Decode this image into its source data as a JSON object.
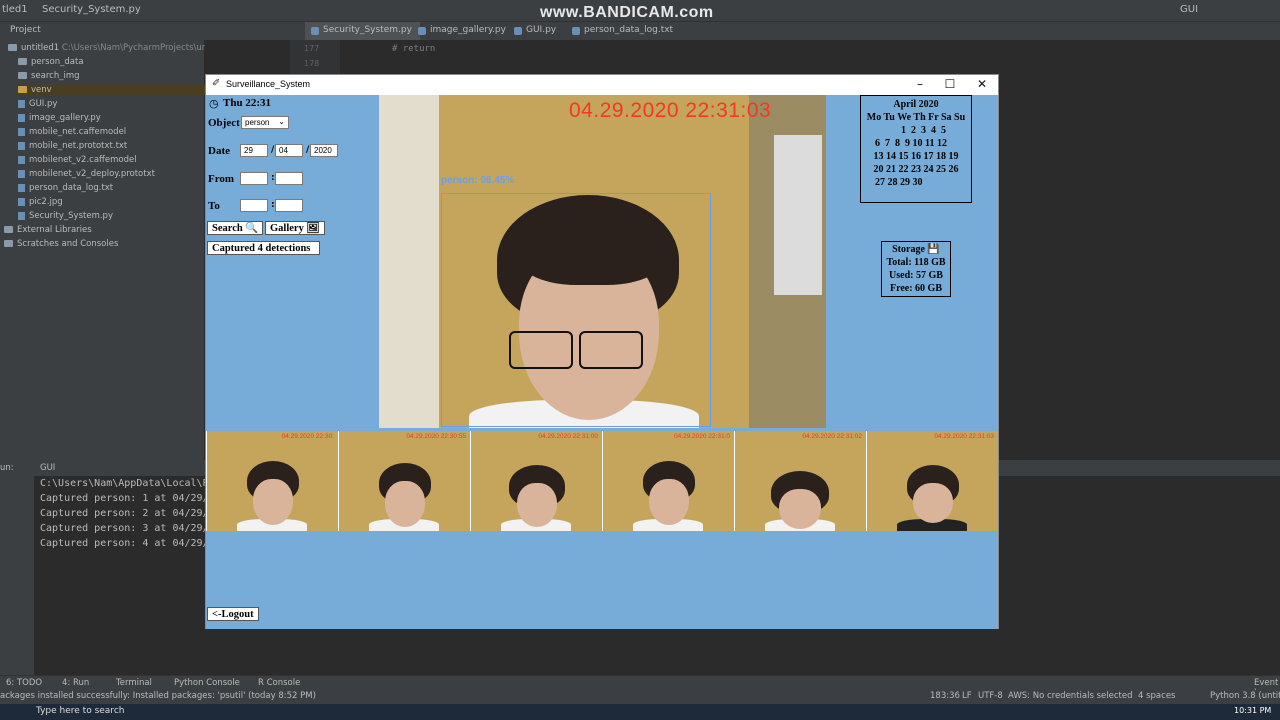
{
  "watermark": "www.BANDICAM.com",
  "ide": {
    "title_project": "tled1",
    "title_file": "Security_System.py",
    "project_label": "Project",
    "config": "GUI",
    "tabs": [
      "Security_System.py",
      "image_gallery.py",
      "GUI.py",
      "person_data_log.txt"
    ],
    "tree": [
      {
        "label": "untitled1",
        "extra": "C:\\Users\\Nam\\PycharmProjects\\untitled1",
        "type": "folder"
      },
      {
        "label": "person_data",
        "type": "folder"
      },
      {
        "label": "search_img",
        "type": "folder"
      },
      {
        "label": "venv",
        "type": "folder"
      },
      {
        "label": "GUI.py",
        "type": "file"
      },
      {
        "label": "image_gallery.py",
        "type": "file"
      },
      {
        "label": "mobile_net.caffemodel",
        "type": "file"
      },
      {
        "label": "mobile_net.prototxt.txt",
        "type": "file"
      },
      {
        "label": "mobilenet_v2.caffemodel",
        "type": "file"
      },
      {
        "label": "mobilenet_v2_deploy.prototxt",
        "type": "file"
      },
      {
        "label": "person_data_log.txt",
        "type": "file"
      },
      {
        "label": "pic2.jpg",
        "type": "file"
      },
      {
        "label": "Security_System.py",
        "type": "file"
      },
      {
        "label": "External Libraries",
        "type": "folder"
      },
      {
        "label": "Scratches and Consoles",
        "type": "folder"
      }
    ],
    "line_numbers": [
      "177",
      "178"
    ],
    "code_comment": "# return",
    "run_label": "un:",
    "run_tab": "GUI",
    "run_output": [
      "C:\\Users\\Nam\\AppData\\Local\\Pro",
      "Captured person: 1 at 04/29/20",
      "Captured person: 2 at 04/29/20",
      "Captured person: 3 at 04/29/20",
      "Captured person: 4 at 04/29/20"
    ],
    "bottom_tabs": [
      "6: TODO",
      "4: Run",
      "Terminal",
      "Python Console",
      "R Console",
      "Event L"
    ],
    "status_message": "ackages installed successfully: Installed packages: 'psutil' (today 8:52 PM)",
    "status_right": [
      "183:36",
      "LF",
      "UTF-8",
      "AWS: No credentials selected",
      "4 spaces",
      "Python 3.8 (untitle"
    ],
    "taskbar_search": "Type here to search",
    "taskbar_time": "10:31 PM"
  },
  "app": {
    "window_title": "Surveillance_System",
    "clock": "Thu 22:31",
    "object_label": "Object",
    "object_value": "person",
    "date_label": "Date",
    "date_day": "29",
    "date_month": "04",
    "date_year": "2020",
    "from_label": "From",
    "to_label": "To",
    "search_button": "Search 🔍",
    "gallery_button": "Gallery 🖼",
    "detections_text": "Captured 4 detections",
    "logout_button": "<-Logout",
    "video_timestamp": "04.29.2020  22:31:03",
    "detection_label": "person: 96.45%",
    "thumb_timestamps": [
      "04.29.2020 22:30:",
      "04.29.2020 22:30:55",
      "04.29.2020 22:31:00",
      "04.29.2020 22:31:0",
      "04.29.2020 22:31:02",
      "04.29.2020 22:31:03"
    ],
    "calendar": {
      "title": "April 2020",
      "header": "Mo Tu We Th Fr Sa Su",
      "rows": [
        "1  2  3  4  5",
        "6  7  8  9 10 11 12",
        "13 14 15 16 17 18 19",
        "20 21 22 23 24 25 26",
        "27 28 29 30"
      ]
    },
    "storage": {
      "title": "Storage 💾",
      "total": "Total: 118 GB",
      "used": "Used: 57 GB",
      "free": "Free: 60 GB"
    }
  },
  "colors": {
    "panel_blue": "#78acd8",
    "timestamp_red": "#f03a23",
    "bbox_blue": "#6f9ee6"
  }
}
